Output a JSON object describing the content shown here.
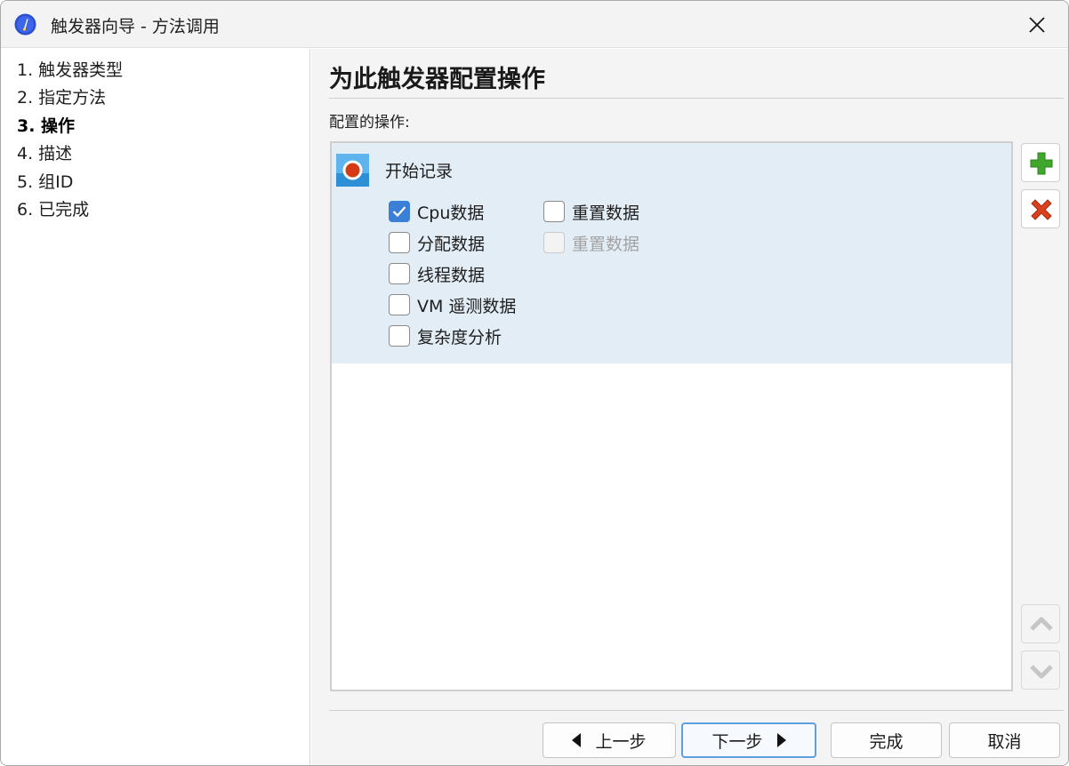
{
  "window": {
    "title": "触发器向导 - 方法调用",
    "app_icon": "profiler-app-icon",
    "close_icon": "close-icon"
  },
  "steps": [
    {
      "label": "1. 触发器类型",
      "active": false
    },
    {
      "label": "2. 指定方法",
      "active": false
    },
    {
      "label": "3. 操作",
      "active": true
    },
    {
      "label": "4. 描述",
      "active": false
    },
    {
      "label": "5. 组ID",
      "active": false
    },
    {
      "label": "6. 已完成",
      "active": false
    }
  ],
  "main": {
    "page_title": "为此触发器配置操作",
    "section_label": "配置的操作:"
  },
  "action": {
    "name": "开始记录",
    "icon": "record-icon",
    "options": {
      "cpu": {
        "label": "Cpu数据",
        "checked": true,
        "enabled": true
      },
      "alloc": {
        "label": "分配数据",
        "checked": false,
        "enabled": true
      },
      "thread": {
        "label": "线程数据",
        "checked": false,
        "enabled": true
      },
      "vm": {
        "label": "VM 遥测数据",
        "checked": false,
        "enabled": true
      },
      "complexity": {
        "label": "复杂度分析",
        "checked": false,
        "enabled": true
      },
      "reset1": {
        "label": "重置数据",
        "checked": false,
        "enabled": true
      },
      "reset2": {
        "label": "重置数据",
        "checked": false,
        "enabled": false
      }
    }
  },
  "side_buttons": {
    "add": {
      "icon": "add-icon",
      "enabled": true
    },
    "remove": {
      "icon": "delete-icon",
      "enabled": true
    },
    "up": {
      "icon": "move-up-icon",
      "enabled": false
    },
    "down": {
      "icon": "move-down-icon",
      "enabled": false
    }
  },
  "footer": {
    "back_label": "上一步",
    "next_label": "下一步",
    "finish_label": "完成",
    "cancel_label": "取消"
  },
  "colors": {
    "accent": "#3b7fd6",
    "selection_bg": "#e3edf6",
    "add_green": "#3fa82c",
    "delete_red": "#d9411e"
  }
}
